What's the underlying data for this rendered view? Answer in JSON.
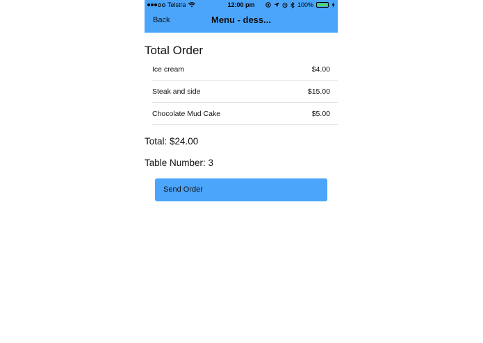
{
  "status_bar": {
    "carrier": "Telstra",
    "time": "12:00 pm",
    "battery": "100%",
    "icons": [
      "signal-dots-icon",
      "wifi-icon",
      "location-icon",
      "navigation-icon",
      "alarm-icon",
      "bluetooth-icon",
      "battery-icon",
      "charging-icon"
    ]
  },
  "nav": {
    "back_label": "Back",
    "title": "Menu - dess..."
  },
  "order": {
    "title": "Total Order",
    "items": [
      {
        "name": "Ice cream",
        "price": "$4.00"
      },
      {
        "name": "Steak and side",
        "price": "$15.00"
      },
      {
        "name": "Chocolate Mud Cake",
        "price": "$5.00"
      }
    ],
    "total": "Total: $24.00",
    "table": "Table Number: 3",
    "send_label": "Send Order"
  },
  "colors": {
    "accent": "#4aa5fb",
    "battery": "#4cd964"
  }
}
